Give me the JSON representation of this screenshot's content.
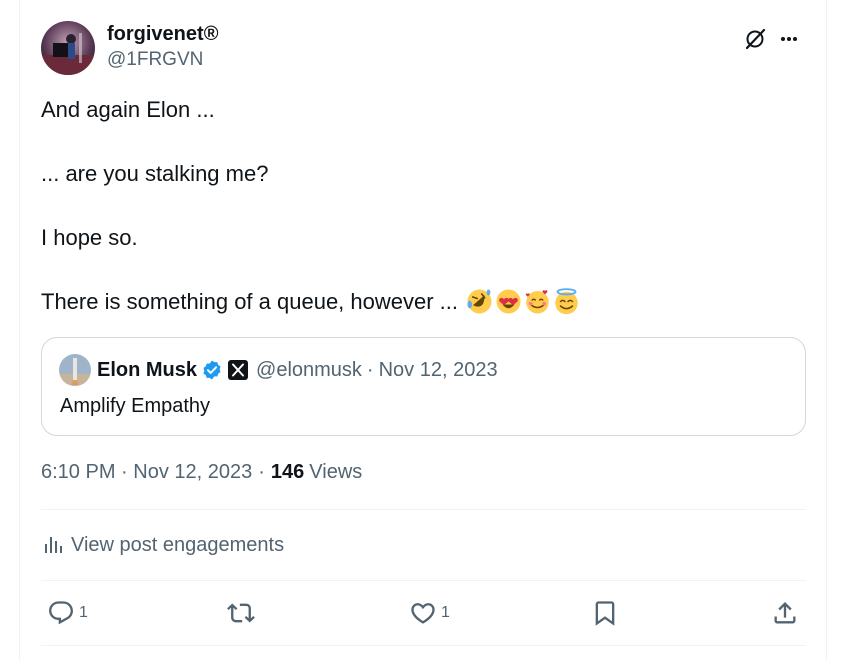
{
  "tweet": {
    "author": {
      "display_name": "forgivenet",
      "registered_mark": "®",
      "handle": "@1FRGVN",
      "avatar_icon": "avatar-photo-icon"
    },
    "paragraphs": [
      "And again Elon ...",
      "... are you stalking me?",
      "I hope so.",
      "There is something of a queue, however ..."
    ],
    "emojis": [
      "rolling-laughing-emoji",
      "heart-eyes-emoji",
      "smiling-hearts-emoji",
      "halo-emoji"
    ],
    "timestamp": "6:10 PM · Nov 12, 2023",
    "dot": "·",
    "views_count": "146",
    "views_label": "Views",
    "engagements_label": "View post engagements"
  },
  "quote": {
    "display_name": "Elon Musk",
    "handle": "@elonmusk",
    "separator": "·",
    "date": "Nov 12, 2023",
    "text": "Amplify Empathy"
  },
  "actions": {
    "reply_count": "1",
    "retweet_count": "",
    "like_count": "1"
  },
  "colors": {
    "text": "#0f1419",
    "secondary": "#536471",
    "border": "#cfd9de",
    "verified": "#1d9bf0"
  }
}
